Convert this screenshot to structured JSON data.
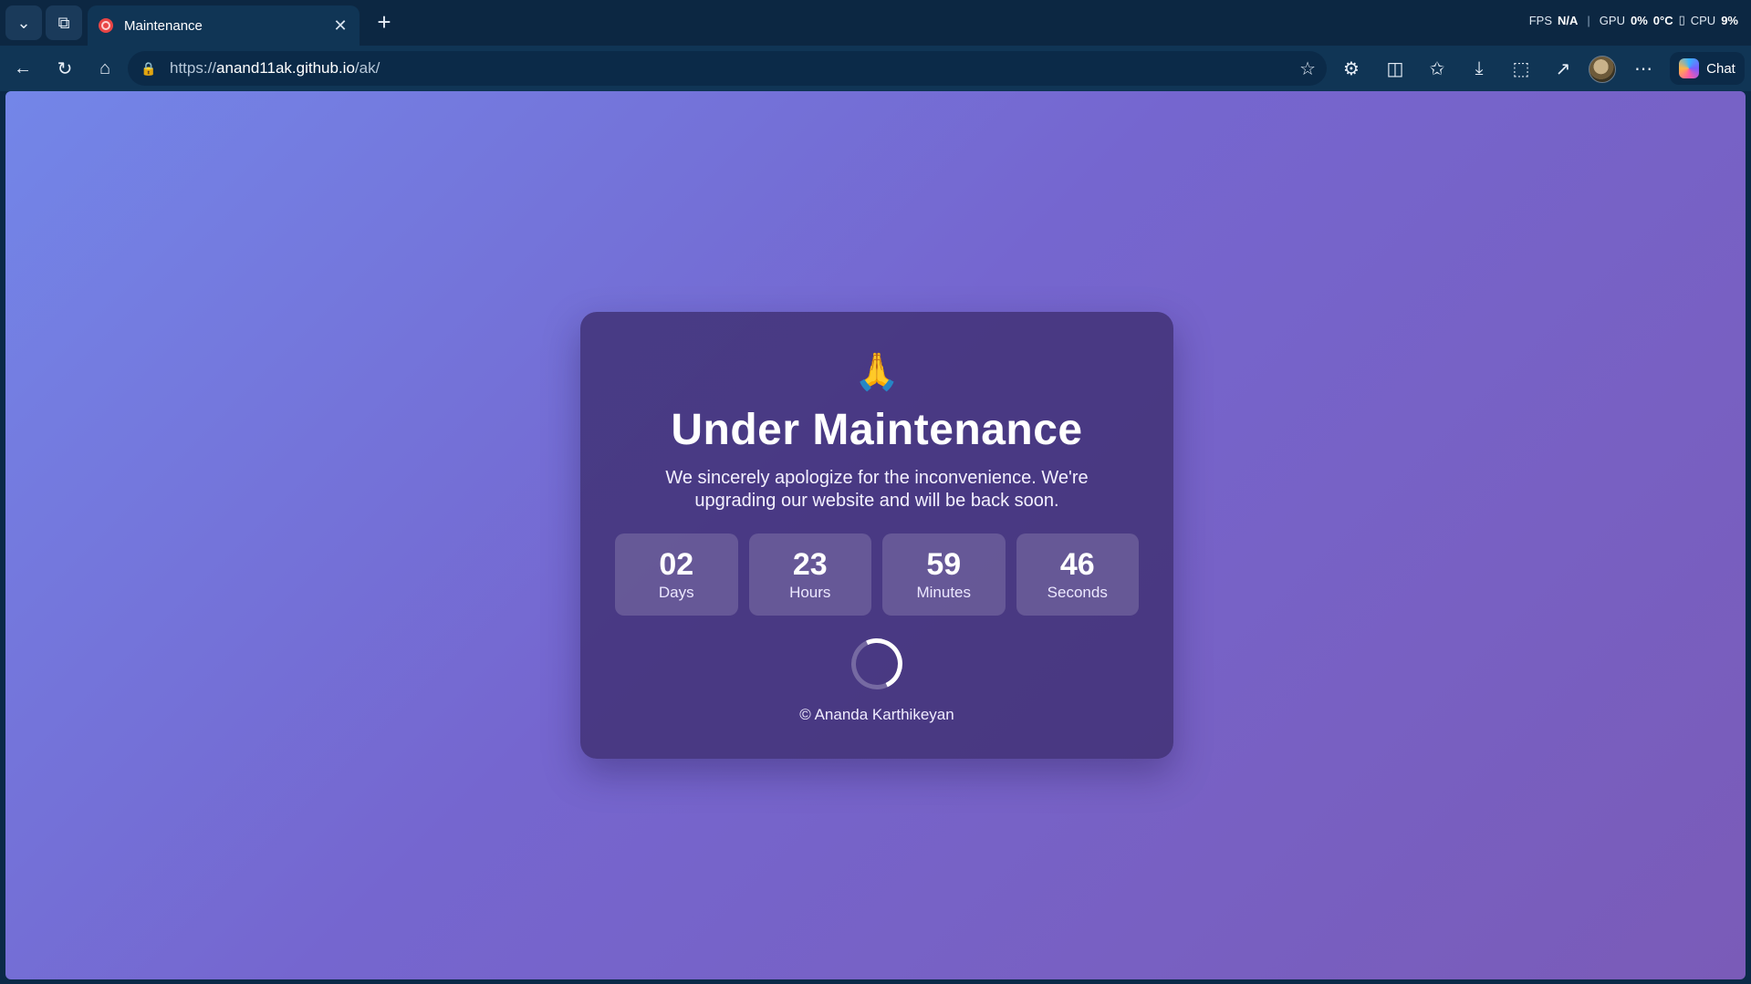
{
  "browser": {
    "tab": {
      "title": "Maintenance",
      "close": "✕"
    },
    "new_tab": "+",
    "perf": {
      "fps_label": "FPS",
      "fps_value": "N/A",
      "gpu_label": "GPU",
      "gpu_value": "0%",
      "temp_value": "0°C",
      "cpu_label": "CPU",
      "cpu_value": "9%"
    },
    "url": {
      "scheme": "https://",
      "host": "anand11ak.github.io",
      "path": "/ak/"
    },
    "chat_label": "Chat",
    "icons": {
      "tab_actions": "chevron-down-icon",
      "workspaces": "workspaces-icon",
      "back": "back-arrow-icon",
      "refresh": "refresh-icon",
      "home": "home-icon",
      "lock": "lock-icon",
      "favorite": "star-icon",
      "extensions": "puzzle-icon",
      "split": "split-screen-icon",
      "favorites": "favorites-icon",
      "downloads": "download-icon",
      "capture": "screenshot-icon",
      "share": "share-icon",
      "more": "more-icon"
    }
  },
  "page": {
    "emoji": "🙏",
    "title": "Under Maintenance",
    "message": "We sincerely apologize for the inconvenience. We're upgrading our website and will be back soon.",
    "countdown": [
      {
        "value": "02",
        "label": "Days"
      },
      {
        "value": "23",
        "label": "Hours"
      },
      {
        "value": "59",
        "label": "Minutes"
      },
      {
        "value": "46",
        "label": "Seconds"
      }
    ],
    "footer": "© Ananda Karthikeyan"
  },
  "colors": {
    "chrome_dark": "#0c2742",
    "chrome": "#103555",
    "gradient_start": "#7386e8",
    "gradient_end": "#7a5bb8",
    "card": "#3c2d6e"
  }
}
